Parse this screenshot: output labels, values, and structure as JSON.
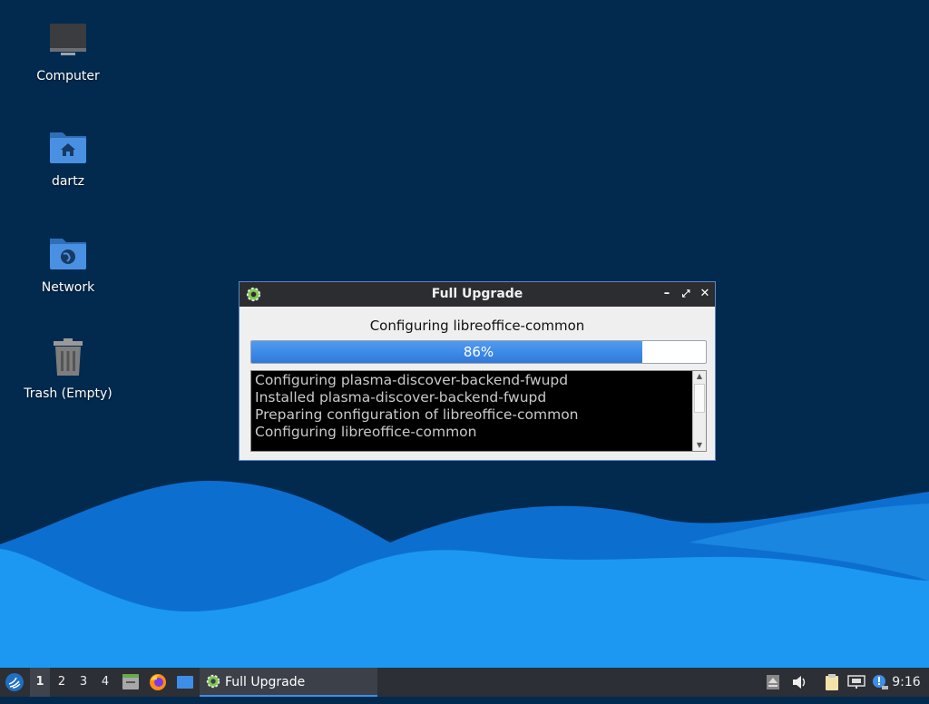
{
  "desktop": {
    "icons": [
      {
        "label": "Computer",
        "icon": "monitor-icon"
      },
      {
        "label": "dartz",
        "icon": "home-folder-icon"
      },
      {
        "label": "Network",
        "icon": "network-folder-icon"
      },
      {
        "label": "Trash (Empty)",
        "icon": "trash-icon"
      }
    ]
  },
  "window": {
    "title": "Full Upgrade",
    "status": "Configuring libreoffice-common",
    "progress_percent": 86,
    "progress_label": "86%",
    "log_lines": [
      "Configuring plasma-discover-backend-fwupd",
      "Installed plasma-discover-backend-fwupd",
      "Preparing configuration of libreoffice-common",
      "Configuring libreoffice-common"
    ]
  },
  "taskbar": {
    "workspaces": [
      "1",
      "2",
      "3",
      "4"
    ],
    "active_workspace": "1",
    "task_label": "Full Upgrade",
    "clock": "9:16"
  },
  "colors": {
    "desktop_bg": "#022a4f",
    "wave_light": "#1f9bf5",
    "accent": "#3d8ee8"
  }
}
